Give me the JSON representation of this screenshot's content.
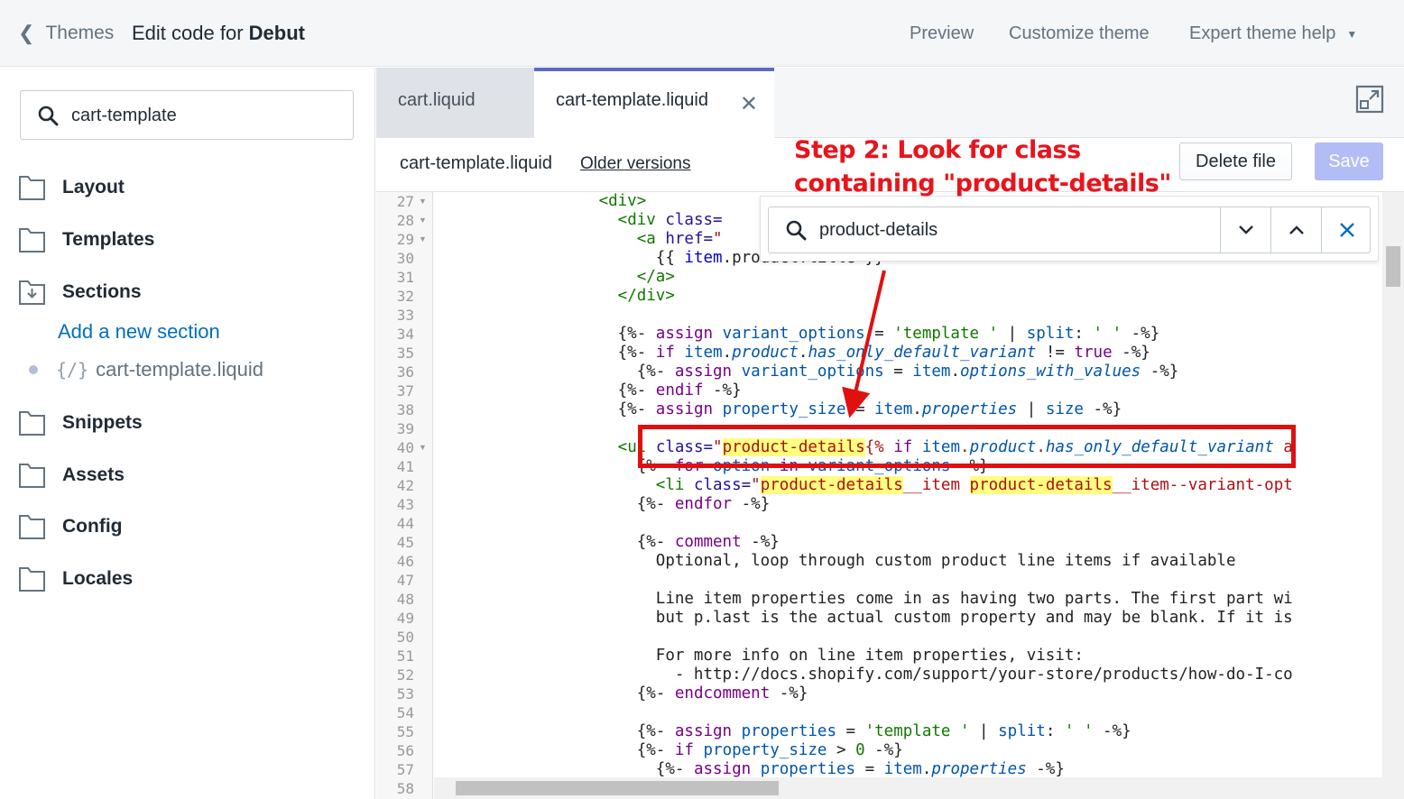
{
  "topbar": {
    "back_label": "Themes",
    "title_prefix": "Edit code for ",
    "title_theme": "Debut",
    "nav": [
      "Preview",
      "Customize theme",
      "Expert theme help"
    ]
  },
  "sidebar": {
    "search_value": "cart-template",
    "folders": [
      "Layout",
      "Templates",
      "Sections",
      "Snippets",
      "Assets",
      "Config",
      "Locales"
    ],
    "add_section_label": "Add a new section",
    "file_icon_text": "{/}",
    "file_label": "cart-template.liquid"
  },
  "tabs": [
    {
      "label": "cart.liquid"
    },
    {
      "label": "cart-template.liquid"
    }
  ],
  "file_header": {
    "filename": "cart-template.liquid",
    "older_versions": "Older versions",
    "delete_label": "Delete file",
    "save_label": "Save"
  },
  "find": {
    "value": "product-details"
  },
  "annotation": {
    "line1": "Step 2: Look for class",
    "line2": "containing \"product-details\""
  },
  "editor": {
    "line_numbers": [
      "27",
      "28",
      "29",
      "30",
      "31",
      "32",
      "33",
      "34",
      "35",
      "36",
      "37",
      "38",
      "39",
      "40",
      "41",
      "42",
      "43",
      "44",
      "45",
      "46",
      "47",
      "48",
      "49",
      "50",
      "51",
      "52",
      "53",
      "54",
      "55",
      "56",
      "57",
      "58"
    ],
    "folded_lines": [
      "27",
      "28",
      "29",
      "40"
    ]
  },
  "colors": {
    "accent": "#5c6ac4",
    "link": "#006fbb",
    "save_disabled": "#b3bcf5",
    "annotation_red": "#e8141c",
    "match_highlight": "#ffff80"
  }
}
